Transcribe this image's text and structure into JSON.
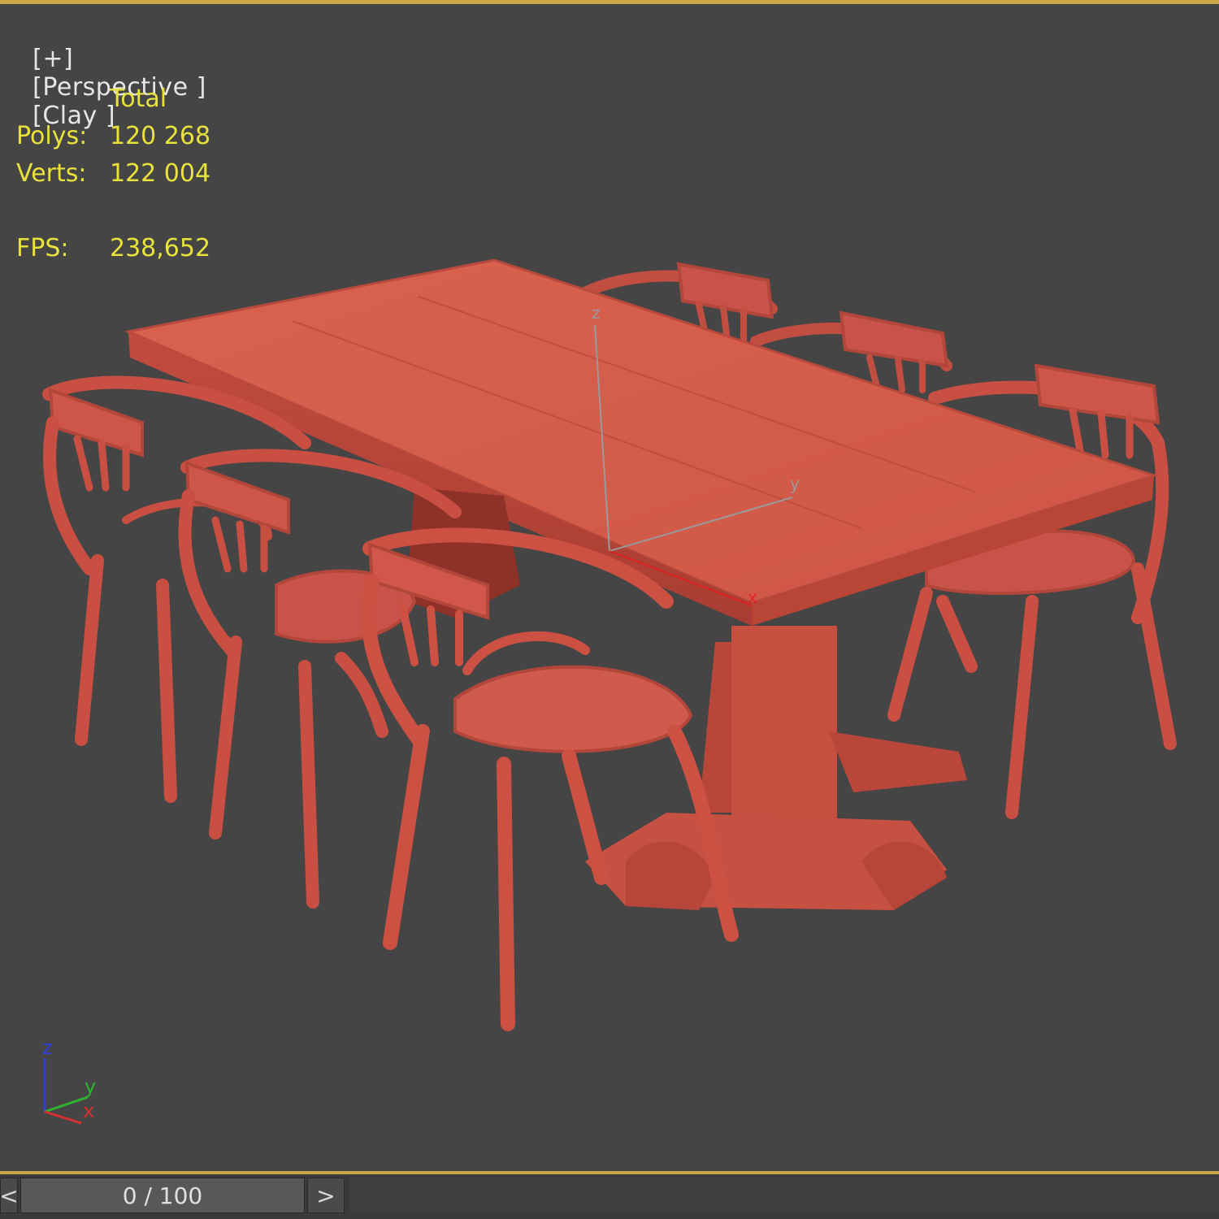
{
  "viewport": {
    "label_plus": "[+]",
    "label_view": "[Perspective ]",
    "label_shading": "[Clay ]"
  },
  "stats": {
    "header": "Total",
    "polys_label": "Polys:",
    "polys_value": "120 268",
    "verts_label": "Verts:",
    "verts_value": "122 004",
    "fps_label": "FPS:",
    "fps_value": "238,652"
  },
  "gizmo": {
    "axis_z": "z",
    "axis_y": "y",
    "axis_x": "x"
  },
  "timeline": {
    "prev_label": "<",
    "frame_display": "0 / 100",
    "next_label": ">"
  },
  "colors": {
    "frame_border": "#caa84a",
    "stats_text": "#e8e23a",
    "clay_model": "#d4574a",
    "viewport_bg": "#454545"
  },
  "icons": [
    "viewcube-axis-tripod-icon",
    "pivot-gizmo-icon"
  ]
}
